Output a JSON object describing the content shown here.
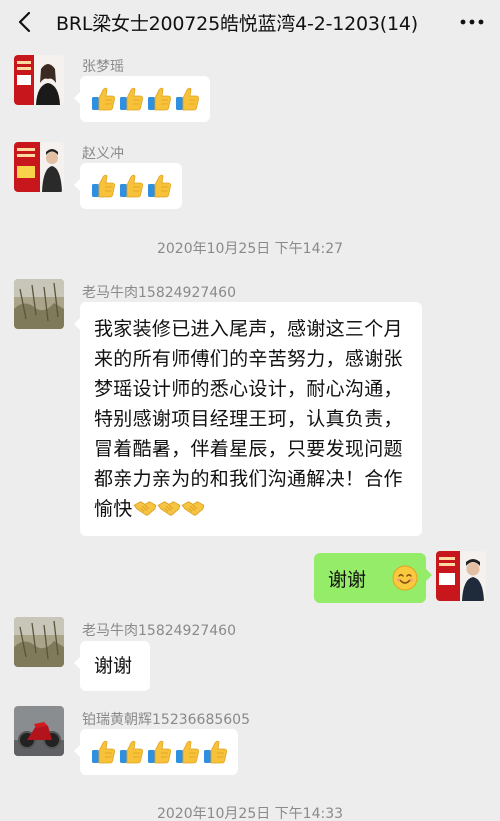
{
  "header": {
    "title": "BRL梁女士200725皓悦蓝湾4-2-1203(14)"
  },
  "messages": [
    {
      "sender": "张梦瑶",
      "content": "👍👍👍👍"
    },
    {
      "sender": "赵义冲",
      "content": "👍👍👍"
    },
    {
      "timestamp": "2020年10月25日 下午14:27"
    },
    {
      "sender": "老马牛肉15824927460",
      "text": "我家装修已进入尾声，感谢这三个月来的所有师傅们的辛苦努力，感谢张梦瑶设计师的悉心设计，耐心沟通，特别感谢项目经理王珂，认真负责，冒着酷暑，伴着星辰，只要发现问题都亲力亲为的和我们沟通解决！合作愉快",
      "text_emoji": "🤝🤝🤝"
    },
    {
      "mine": true,
      "text": "谢谢",
      "emoji": "😊"
    },
    {
      "sender": "老马牛肉15824927460",
      "text": "谢谢"
    },
    {
      "sender": "铂瑞黄朝辉15236685605",
      "content": "👍👍👍👍👍"
    },
    {
      "timestamp": "2020年10月25日 下午14:33"
    }
  ],
  "colors": {
    "background": "#ededed",
    "bubble": "#ffffff",
    "own_bubble": "#95ec69",
    "meta_text": "#8a8a8a"
  },
  "icons": {
    "back": "back-chevron-icon",
    "more": "more-dots-icon",
    "thumb": "thumbs-up-emoji",
    "handshake": "handshake-emoji",
    "smile": "smile-emoji"
  }
}
